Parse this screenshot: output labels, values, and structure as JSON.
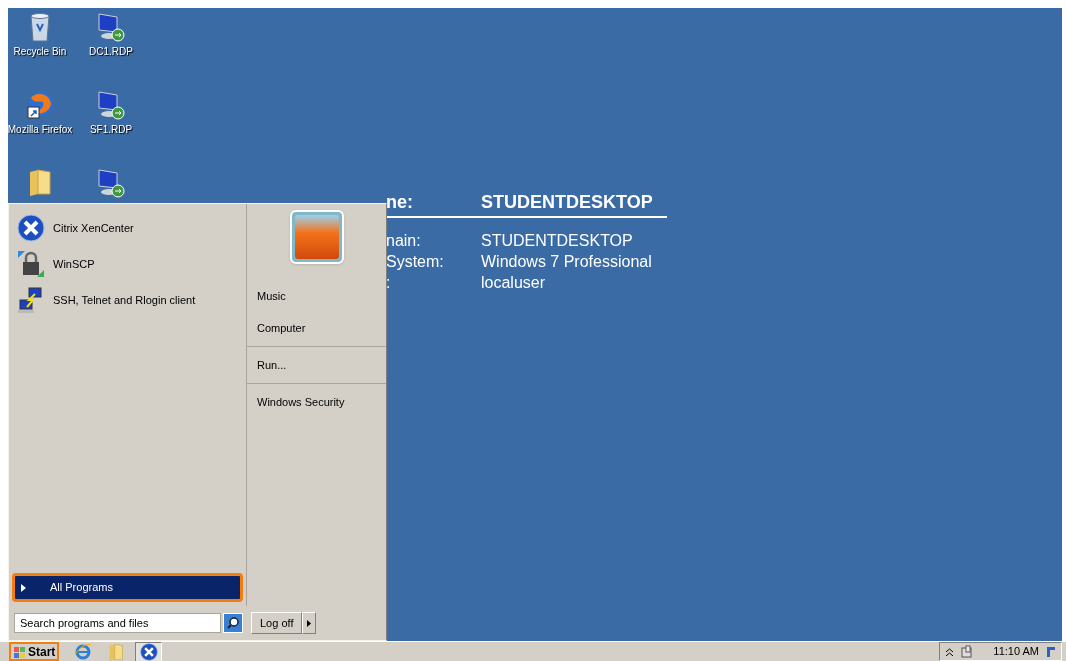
{
  "desktop": {
    "icons": [
      {
        "kind": "recycle-bin",
        "label": "Recycle Bin"
      },
      {
        "kind": "rdp",
        "label": "DC1.RDP"
      },
      {
        "kind": "firefox",
        "label": "Mozilla Firefox"
      },
      {
        "kind": "rdp",
        "label": "SF1.RDP"
      },
      {
        "kind": "folder"
      },
      {
        "kind": "rdp"
      }
    ]
  },
  "info": {
    "heading": {
      "label": "ne:",
      "value": "STUDENTDESKTOP"
    },
    "rows": [
      {
        "label": "nain:",
        "value": "STUDENTDESKTOP"
      },
      {
        "label": "System:",
        "value": "Windows 7 Professional"
      },
      {
        "label": ":",
        "value": "localuser"
      }
    ]
  },
  "start_menu": {
    "pinned": [
      {
        "kind": "citrix",
        "label": "Citrix XenCenter"
      },
      {
        "kind": "winscp",
        "label": "WinSCP"
      },
      {
        "kind": "ssh",
        "label": "SSH, Telnet and Rlogin client"
      }
    ],
    "all_programs": {
      "label": "All Programs",
      "selected": true
    },
    "search": {
      "placeholder": "Search programs and files"
    },
    "right_groups": [
      [
        {
          "label": "Music"
        },
        {
          "label": "Computer"
        }
      ],
      [
        {
          "label": "Run..."
        }
      ],
      [
        {
          "label": "Windows Security"
        }
      ]
    ],
    "log_off": {
      "label": "Log off"
    }
  },
  "taskbar": {
    "start": {
      "label": "Start"
    },
    "quick_launch": [
      {
        "kind": "ie",
        "active": false
      },
      {
        "kind": "folder",
        "active": false
      },
      {
        "kind": "citrix",
        "active": true
      }
    ],
    "clock": "11:10 AM"
  }
}
